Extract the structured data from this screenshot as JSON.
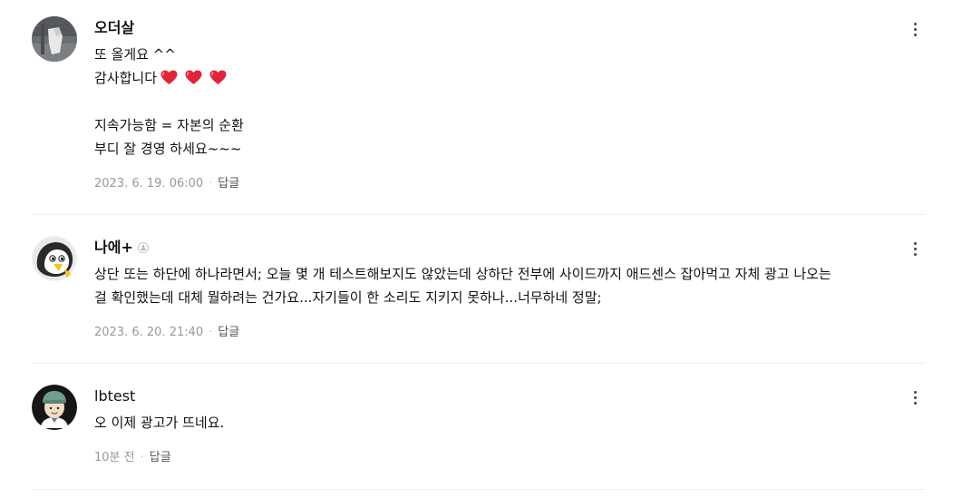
{
  "comments": [
    {
      "author": "오더살",
      "lines": [
        "또 올게요 ^^",
        "감사합니다",
        "",
        "지속가능함 = 자본의 순환",
        "부디 잘 경영 하세요~~~"
      ],
      "heart_emoji_count": 3,
      "date": "2023. 6. 19. 06:00",
      "reply_label": "답글",
      "more_icon": "kebab-vertical-icon"
    },
    {
      "author": "나에+",
      "author_badge_icon": "person-badge-icon",
      "lines": [
        "상단 또는 하단에 하나라면서; 오늘 몇 개 테스트해보지도 않았는데 상하단 전부에 사이드까지 애드센스 잡아먹고 자체 광고 나오는",
        "걸 확인했는데 대체 뭘하려는 건가요...자기들이 한 소리도 지키지 못하나...너무하네 정말;"
      ],
      "date": "2023. 6. 20. 21:40",
      "reply_label": "답글",
      "more_icon": "kebab-vertical-icon"
    },
    {
      "author": "lbtest",
      "lines": [
        "오 이제 광고가 뜨네요."
      ],
      "date": "10분 전",
      "reply_label": "답글",
      "more_icon": "kebab-vertical-icon"
    }
  ],
  "colors": {
    "text": "#111111",
    "meta": "#999999",
    "reply": "#555555",
    "divider": "#efefef",
    "heart": "#e0243a"
  }
}
